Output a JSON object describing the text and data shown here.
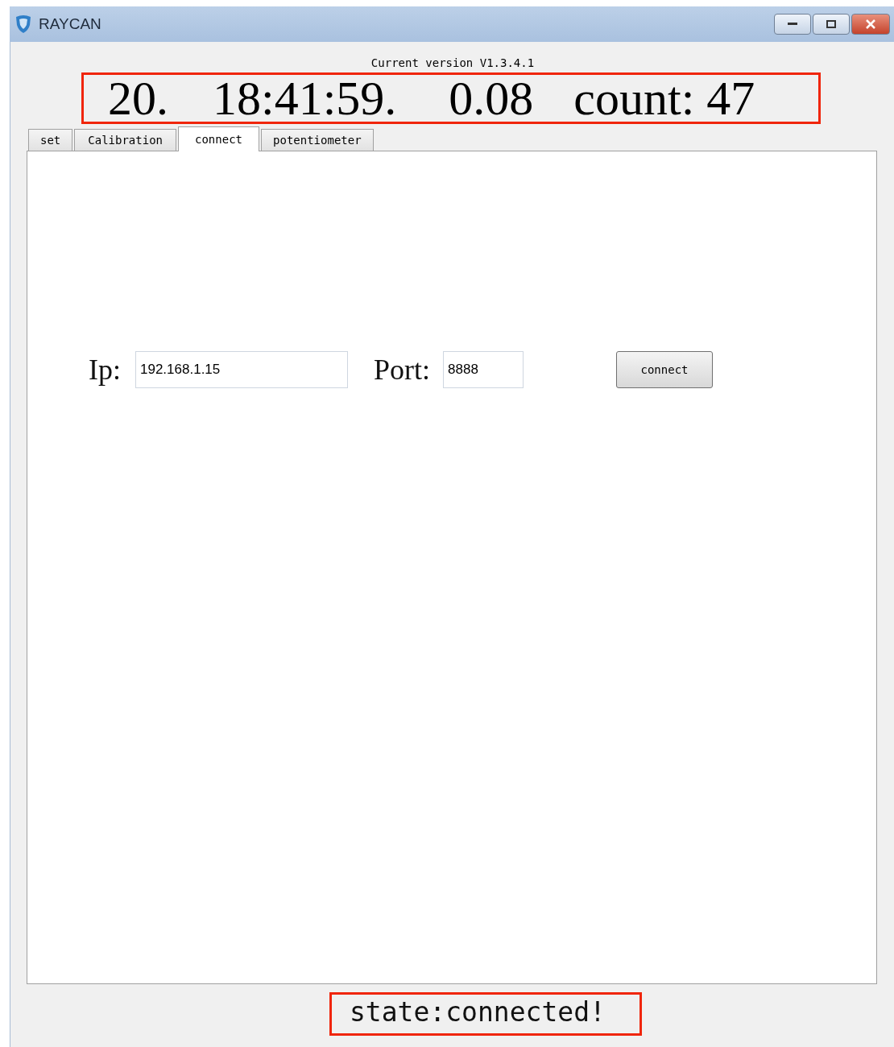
{
  "window": {
    "title": "RAYCAN"
  },
  "version": "Current version V1.3.4.1",
  "readings": [
    "20.",
    "18:41:59.",
    "0.08",
    "count: 47"
  ],
  "tabs": [
    {
      "label": "set",
      "selected": false
    },
    {
      "label": "Calibration",
      "selected": false
    },
    {
      "label": "connect",
      "selected": true
    },
    {
      "label": "potentiometer",
      "selected": false
    }
  ],
  "connection": {
    "ip_label": "Ip:",
    "ip_value": "192.168.1.15",
    "port_label": "Port:",
    "port_value": "8888",
    "button": "connect"
  },
  "status": "state:connected!"
}
